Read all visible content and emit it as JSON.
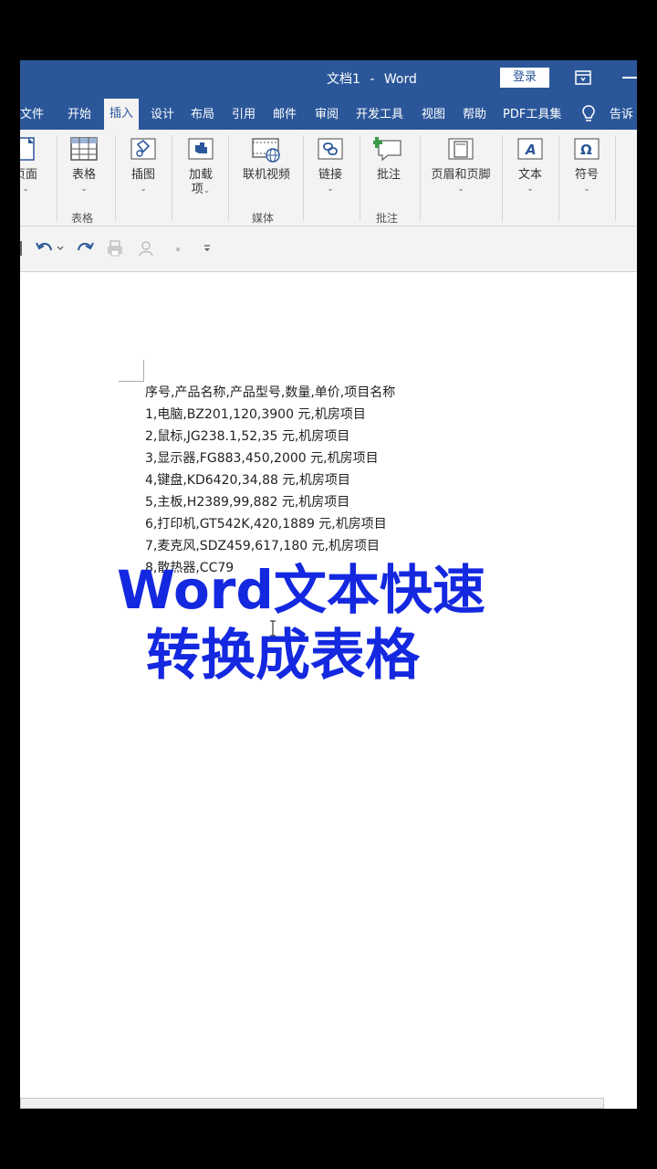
{
  "window": {
    "doc_name": "文档1",
    "separator": "-",
    "app_name": "Word",
    "login_label": "登录"
  },
  "tabs": [
    {
      "label": "文件"
    },
    {
      "label": "开始"
    },
    {
      "label": "插入",
      "active": true
    },
    {
      "label": "设计"
    },
    {
      "label": "布局"
    },
    {
      "label": "引用"
    },
    {
      "label": "邮件"
    },
    {
      "label": "审阅"
    },
    {
      "label": "开发工具"
    },
    {
      "label": "视图"
    },
    {
      "label": "帮助"
    },
    {
      "label": "PDF工具集"
    },
    {
      "label": "告诉"
    }
  ],
  "ribbon": {
    "pages_label": "页面",
    "table_label": "表格",
    "table_group": "表格",
    "illustrations_label": "插图",
    "addins_label_1": "加载",
    "addins_label_2": "项",
    "online_video_label": "联机视频",
    "media_group": "媒体",
    "link_label": "链接",
    "comment_label": "批注",
    "comment_group": "批注",
    "header_footer_label": "页眉和页脚",
    "text_label": "文本",
    "symbols_label": "符号",
    "chevron": "⌄"
  },
  "icons": {
    "undo": "undo-icon",
    "redo": "redo-icon",
    "customize": "customize-qat-icon",
    "accent": "#2b579a"
  },
  "document": {
    "lines": [
      "序号,产品名称,产品型号,数量,单价,项目名称",
      "1,电脑,BZ201,120,3900 元,机房项目",
      "2,鼠标,JG238.1,52,35 元,机房项目",
      "3,显示器,FG883,450,2000 元,机房项目",
      "4,键盘,KD6420,34,88 元,机房项目",
      "5,主板,H2389,99,882 元,机房项目",
      "6,打印机,GT542K,420,1889 元,机房项目",
      "7,麦克风,SDZ459,617,180 元,机房项目",
      "8,散热器,CC79"
    ]
  },
  "overlay": {
    "line1": "Word文本快速",
    "line2": "转换成表格",
    "color": "#1428e0"
  }
}
